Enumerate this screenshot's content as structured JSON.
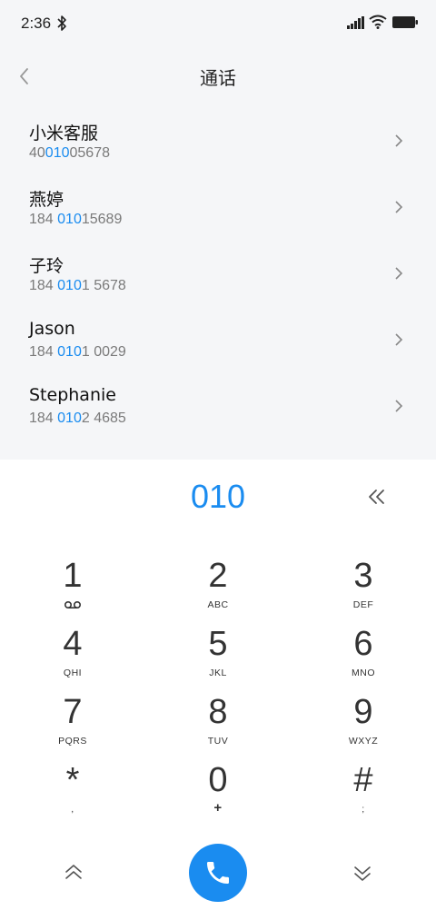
{
  "status_bar": {
    "time": "2:36"
  },
  "header": {
    "title": "通话"
  },
  "contacts": [
    {
      "name": "小米客服",
      "number_pre": "40",
      "number_hl": "010",
      "number_post": "05678"
    },
    {
      "name": "燕婷",
      "number_pre": "184 ",
      "number_hl": "010",
      "number_post": "15689"
    },
    {
      "name": "子玲",
      "number_pre": "184 ",
      "number_hl": "010",
      "number_post": "1 5678"
    },
    {
      "name": "Jason",
      "number_pre": "184 ",
      "number_hl": "010",
      "number_post": "1 0029"
    },
    {
      "name": "Stephanie",
      "number_pre": "184 ",
      "number_hl": "010",
      "number_post": "2 4685"
    }
  ],
  "dialer": {
    "digits": "010",
    "keys": [
      {
        "num": "1",
        "sub": ""
      },
      {
        "num": "2",
        "sub": "ABC"
      },
      {
        "num": "3",
        "sub": "DEF"
      },
      {
        "num": "4",
        "sub": "QHI"
      },
      {
        "num": "5",
        "sub": "JKL"
      },
      {
        "num": "6",
        "sub": "MNO"
      },
      {
        "num": "7",
        "sub": "PQRS"
      },
      {
        "num": "8",
        "sub": "TUV"
      },
      {
        "num": "9",
        "sub": "WXYZ"
      },
      {
        "num": "*",
        "sub": ","
      },
      {
        "num": "0",
        "sub": "+"
      },
      {
        "num": "#",
        "sub": ";"
      }
    ]
  },
  "colors": {
    "accent": "#1a8cf0",
    "list_bg": "#f5f6f8",
    "dialer_bg": "#ffffff"
  },
  "icons": [
    "bluetooth-icon",
    "signal-icon",
    "wifi-icon",
    "battery-icon",
    "back-icon",
    "chevron-right-icon",
    "backspace-icon",
    "voicemail-icon",
    "collapse-up-icon",
    "expand-down-icon",
    "phone-icon"
  ]
}
